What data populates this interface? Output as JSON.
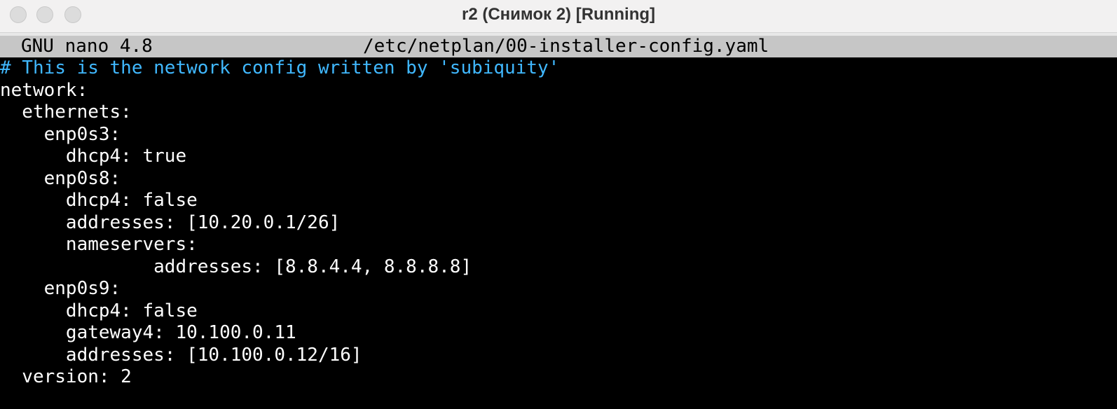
{
  "window": {
    "title": "r2 (Снимок 2) [Running]"
  },
  "nano": {
    "version": "GNU nano 4.8",
    "filename": "/etc/netplan/00-installer-config.yaml"
  },
  "file_lines": [
    "# This is the network config written by 'subiquity'",
    "network:",
    "  ethernets:",
    "    enp0s3:",
    "      dhcp4: true",
    "    enp0s8:",
    "      dhcp4: false",
    "      addresses: [10.20.0.1/26]",
    "      nameservers:",
    "              addresses: [8.8.4.4, 8.8.8.8]",
    "    enp0s9:",
    "      dhcp4: false",
    "      gateway4: 10.100.0.11",
    "      addresses: [10.100.0.12/16]",
    "  version: 2"
  ],
  "colors": {
    "comment": "#40b8ff",
    "text": "#ffffff",
    "background": "#000000",
    "header_bg": "#c6c6c6"
  }
}
